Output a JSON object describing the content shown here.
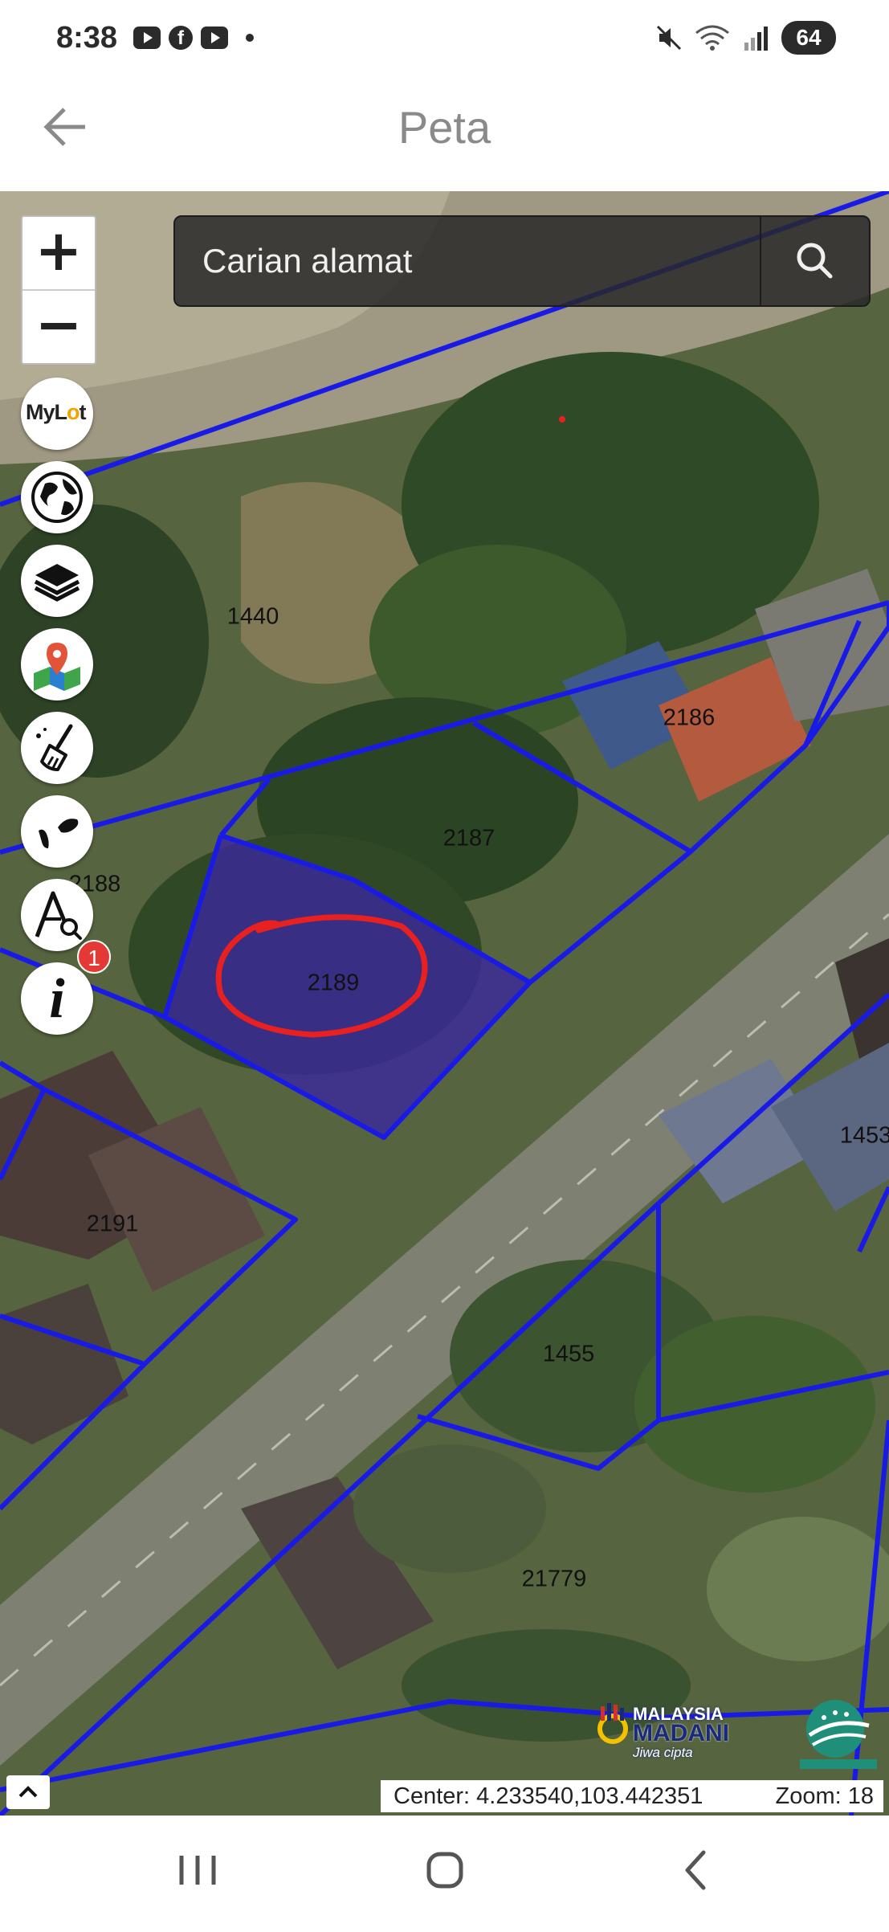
{
  "status_bar": {
    "time": "8:38",
    "battery": "64",
    "left_icons": [
      "youtube-icon",
      "facebook-icon",
      "youtube-icon"
    ],
    "right_icons": [
      "mute-icon",
      "wifi-icon",
      "signal-icon"
    ]
  },
  "header": {
    "title": "Peta",
    "back_icon": "arrow-left-icon"
  },
  "map": {
    "search": {
      "placeholder": "Carian alamat",
      "icon": "search-icon"
    },
    "zoom_in": "+",
    "zoom_out": "−",
    "tools": [
      {
        "name": "mylot-logo",
        "label_1": "My",
        "label_2": "L",
        "label_3": "o",
        "label_4": "t"
      },
      {
        "name": "globe-icon"
      },
      {
        "name": "layers-icon"
      },
      {
        "name": "map-marker-icon"
      },
      {
        "name": "broom-icon"
      },
      {
        "name": "malaysia-map-icon"
      },
      {
        "name": "search-lot-icon"
      },
      {
        "name": "info-icon",
        "glyph": "i"
      }
    ],
    "notification_badge": "1",
    "lot_labels": [
      "1440",
      "2186",
      "2187",
      "2188",
      "2189",
      "2191",
      "1453",
      "1455",
      "21779"
    ],
    "highlighted_lot": "2189",
    "lot_boundary_color": "#1a1ae6",
    "selected_lot_fill": "#3b2a9a",
    "annotation_circle_color": "#e82020",
    "center_label": "Center: 4.233540,103.442351",
    "zoom_label": "Zoom: 18",
    "logos": {
      "madani_line1": "MALAYSIA",
      "madani_line2": "MADANI",
      "madani_line3": "Jiwa cipta"
    }
  },
  "nav_bar": {
    "buttons": [
      "recent-apps-icon",
      "home-icon",
      "back-icon"
    ]
  }
}
